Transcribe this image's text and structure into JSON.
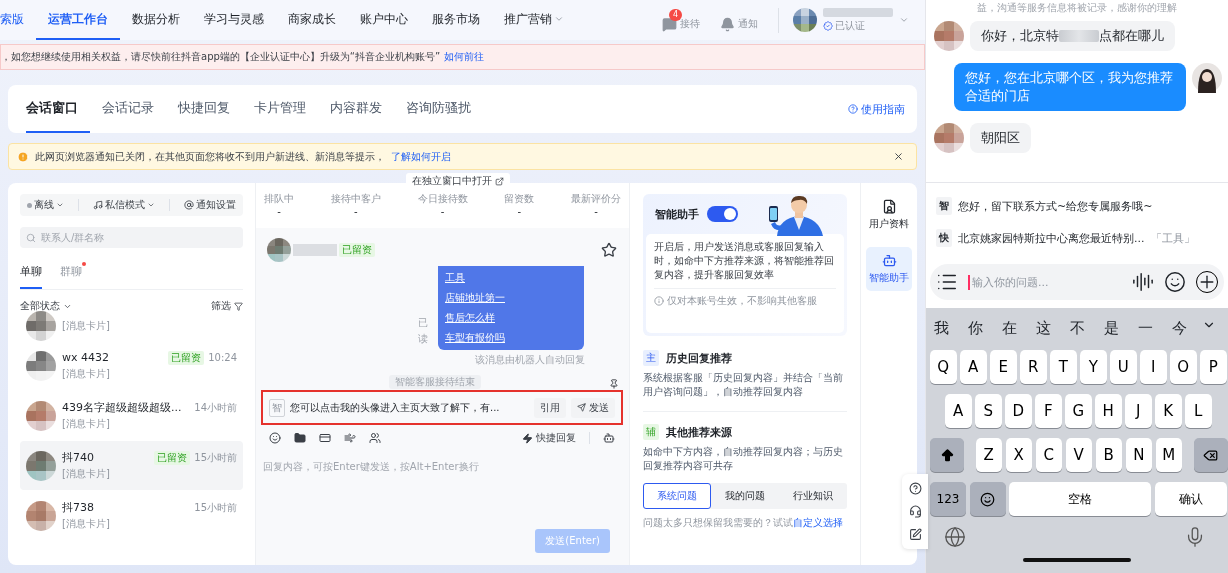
{
  "nav": {
    "items": [
      {
        "label": "索版",
        "selected": false,
        "dropdown": false
      },
      {
        "label": "运营工作台",
        "selected": true,
        "dropdown": false
      },
      {
        "label": "数据分析",
        "selected": false,
        "dropdown": false
      },
      {
        "label": "学习与灵感",
        "selected": false,
        "dropdown": false
      },
      {
        "label": "商家成长",
        "selected": false,
        "dropdown": false
      },
      {
        "label": "账户中心",
        "selected": false,
        "dropdown": false
      },
      {
        "label": "服务市场",
        "selected": false,
        "dropdown": false
      },
      {
        "label": "推广营销",
        "selected": false,
        "dropdown": true
      }
    ],
    "actions": [
      {
        "kind": "chat",
        "label": "接待",
        "badge": "4"
      },
      {
        "kind": "bell",
        "label": "通知"
      }
    ],
    "account": {
      "status": "已认证"
    }
  },
  "banner": {
    "text": "，如您想继续使用相关权益，请尽快前往抖音app端的【企业认证中心】升级为“抖音企业机构账号”",
    "link": "如何前往"
  },
  "tabs": [
    {
      "label": "会话窗口",
      "selected": true
    },
    {
      "label": "会话记录",
      "selected": false
    },
    {
      "label": "快捷回复",
      "selected": false
    },
    {
      "label": "卡片管理",
      "selected": false
    },
    {
      "label": "内容群发",
      "selected": false
    },
    {
      "label": "咨询防骚扰",
      "selected": false
    }
  ],
  "guide": "使用指南",
  "notice": {
    "text": "此网页浏览器通知已关闭，在其他页面您将收不到用户新进线、新消息等提示，",
    "link": "了解如何开启"
  },
  "list": {
    "toolbar": [
      {
        "kind": "status",
        "label": "离线"
      },
      {
        "kind": "mode",
        "label": "私信模式"
      },
      {
        "kind": "settings",
        "label": "通知设置"
      }
    ],
    "search_placeholder": "联系人/群名称",
    "chat_tabs": [
      {
        "label": "单聊",
        "selected": true,
        "dot": false
      },
      {
        "label": "群聊",
        "selected": false,
        "dot": true
      }
    ],
    "status_filter": "全部状态",
    "filter": "筛选",
    "conversations": [
      {
        "preview": "[消息卡片]",
        "selected": false
      },
      {
        "name": "wx 4432",
        "preview": "[消息卡片]",
        "tag": "已留资",
        "time": "10:24",
        "selected": false
      },
      {
        "name": "439名字超级超级超级...",
        "preview": "[消息卡片]",
        "time": "14小时前",
        "selected": false
      },
      {
        "name": "抖740",
        "preview": "[消息卡片]",
        "tag": "已留资",
        "time": "15小时前",
        "selected": true
      },
      {
        "name": "抖738",
        "preview": "[消息卡片]",
        "time": "15小时前",
        "selected": false
      }
    ]
  },
  "chat": {
    "open_window": "在独立窗口中打开",
    "stats": [
      {
        "label": "排队中",
        "value": "-"
      },
      {
        "label": "接待中客户",
        "value": "-"
      },
      {
        "label": "今日接待数",
        "value": "-"
      },
      {
        "label": "留资数",
        "value": "-"
      },
      {
        "label": "最新评价分",
        "value": "-"
      }
    ],
    "contact_tag": "已留资",
    "bubble_links": [
      "工具",
      "店铺地址第一",
      "售后怎么样",
      "车型有报价吗"
    ],
    "read": "已读",
    "bot_caption": "该消息由机器人自动回复",
    "session_end": "智能客服接待结束",
    "suggestion": {
      "tag": "智",
      "text": "您可以点击我的头像进入主页大致了解下，有...",
      "quote": "引用",
      "send": "发送"
    },
    "quick_reply": "快捷回复",
    "input_placeholder": "回复内容，可按Enter键发送，按Alt+Enter换行",
    "send_button": "发送(Enter)"
  },
  "assistant": {
    "title": "智能助手",
    "on": true,
    "description": "开启后，用户发送消息或客服回复输入时，如命中下方推荐来源，将智能推荐回复内容，提升客服回复效率",
    "note": "仅对本账号生效，不影响其他客服",
    "sections": [
      {
        "tag": "主",
        "title": "历史回复推荐",
        "text": "系统根据客服「历史回复内容」并结合「当前用户咨询问题」，自动推荐回复内容"
      },
      {
        "tag": "辅",
        "title": "其他推荐来源",
        "text": "如命中下方内容，自动推荐回复内容；与历史回复推荐内容可共存"
      }
    ],
    "segments": [
      {
        "label": "系统问题",
        "selected": true
      },
      {
        "label": "我的问题",
        "selected": false
      },
      {
        "label": "行业知识",
        "selected": false
      }
    ],
    "footer": "问题太多只想保留我需要的？试试",
    "footer_link": "自定义选择"
  },
  "side_tabs": [
    {
      "kind": "profile",
      "label": "用户资料",
      "selected": false
    },
    {
      "kind": "bot",
      "label": "智能助手",
      "selected": true
    }
  ],
  "phone": {
    "top_note": "益，沟通等服务信息将被记录，感谢你的理解",
    "messages": [
      {
        "kind": "incoming",
        "parts": [
          "你好，北京特",
          "点都在哪儿"
        ]
      },
      {
        "kind": "outgoing",
        "parts": [
          "您好，您在北京哪个区，我为您推荐合适的门店"
        ]
      },
      {
        "kind": "incoming",
        "parts": [
          "朝阳区"
        ]
      }
    ],
    "suggestions": [
      {
        "tag": "智",
        "text": "您好，留下联系方式~给您专属服务哦~"
      },
      {
        "tag": "快",
        "text": "北京姚家园特斯拉中心离您最近特别...",
        "extra": "「工具」"
      }
    ],
    "input_placeholder": "输入你的问题...",
    "candidates": [
      "我",
      "你",
      "在",
      "这",
      "不",
      "是",
      "一",
      "今"
    ],
    "rows": [
      [
        "Q",
        "A",
        "E",
        "R",
        "T",
        "Y",
        "U",
        "I",
        "O",
        "P"
      ],
      [
        "A",
        "S",
        "D",
        "F",
        "G",
        "H",
        "J",
        "K",
        "L"
      ],
      [
        "Z",
        "X",
        "C",
        "V",
        "B",
        "N",
        "M"
      ]
    ],
    "bottom_row": [
      {
        "kind": "num",
        "label": "123"
      },
      {
        "kind": "emoji"
      },
      {
        "kind": "space",
        "label": "空格"
      },
      {
        "kind": "confirm",
        "label": "确认"
      }
    ]
  }
}
